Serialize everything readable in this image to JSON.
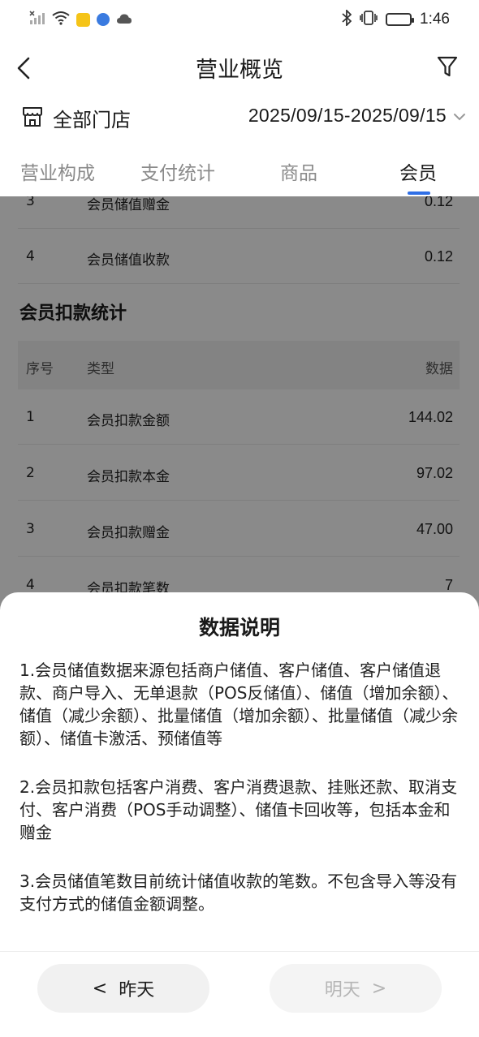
{
  "status_bar": {
    "time": "1:46",
    "icons": [
      "no-signal-icon",
      "wifi-icon",
      "app-notification-icon",
      "browser-icon",
      "cloud-icon",
      "bluetooth-icon",
      "vibrate-icon",
      "battery-icon"
    ]
  },
  "header": {
    "title": "营业概览",
    "back_icon": "chevron-left-icon",
    "filter_icon": "filter-icon"
  },
  "store": {
    "icon": "store-icon",
    "label": "全部门店",
    "date_range": "2025/09/15-2025/09/15"
  },
  "tabs": [
    {
      "label": "营业构成",
      "active": false
    },
    {
      "label": "支付统计",
      "active": false
    },
    {
      "label": "商品",
      "active": false
    },
    {
      "label": "会员",
      "active": true
    }
  ],
  "accent_color": "#2f6fe6",
  "stored_value_rows": [
    {
      "index": "3",
      "type": "会员储值赠金",
      "value": "0.12"
    },
    {
      "index": "4",
      "type": "会员储值收款",
      "value": "0.12"
    }
  ],
  "deduction": {
    "title": "会员扣款统计",
    "headers": {
      "index": "序号",
      "type": "类型",
      "value": "数据"
    },
    "rows": [
      {
        "index": "1",
        "type": "会员扣款金额",
        "value": "144.02"
      },
      {
        "index": "2",
        "type": "会员扣款本金",
        "value": "97.02"
      },
      {
        "index": "3",
        "type": "会员扣款赠金",
        "value": "47.00"
      },
      {
        "index": "4",
        "type": "会员扣款笔数",
        "value": "7"
      }
    ]
  },
  "sheet": {
    "title": "数据说明",
    "notes": [
      "1.会员储值数据来源包括商户储值、客户储值、客户储值退款、商户导入、无单退款（POS反储值）、储值（增加余额）、储值（减少余额）、批量储值（增加余额）、批量储值（减少余额）、储值卡激活、预储值等",
      "2.会员扣款包括客户消费、客户消费退款、挂账还款、取消支付、客户消费（POS手动调整）、储值卡回收等，包括本金和赠金",
      "3.会员储值笔数目前统计储值收款的笔数。不包含导入等没有支付方式的储值金额调整。"
    ],
    "prev_label": "昨天",
    "next_label": "明天",
    "prev_arrow": "<",
    "next_arrow": ">"
  }
}
